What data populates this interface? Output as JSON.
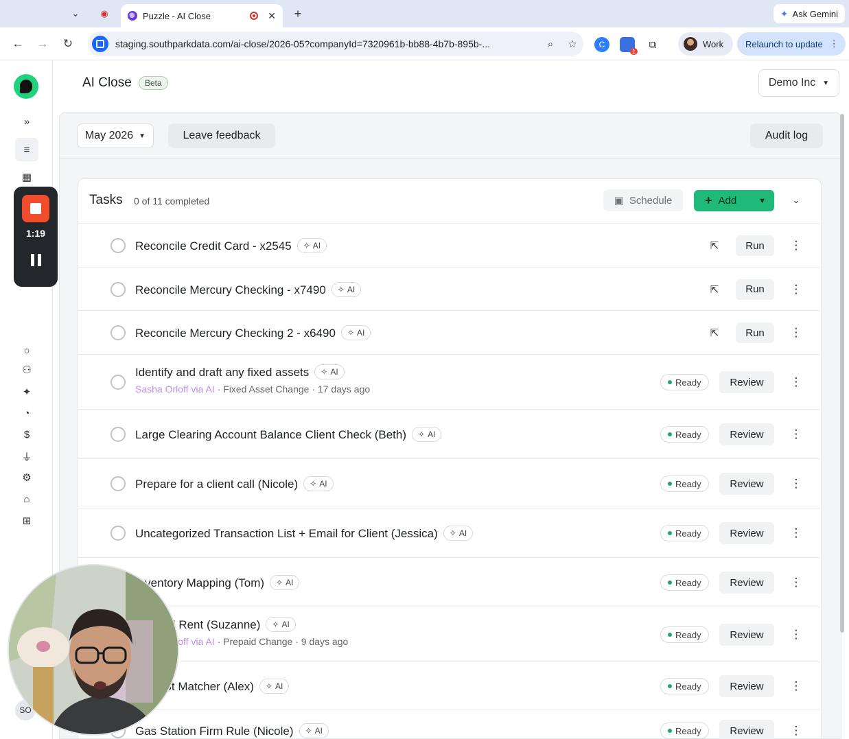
{
  "browser": {
    "active_tab_title": "Puzzle - AI Close",
    "ask_gemini": "Ask Gemini",
    "url": "staging.southparkdata.com/ai-close/2026-05?companyId=7320961b-bb88-4b7b-895b-...",
    "profile_label": "Work",
    "relaunch_label": "Relaunch to update",
    "extension_badge": "1"
  },
  "header": {
    "title": "AI Close",
    "badge": "Beta",
    "company": "Demo Inc"
  },
  "controls": {
    "month": "May 2026",
    "feedback": "Leave feedback",
    "audit": "Audit log"
  },
  "recorder": {
    "time": "1:19"
  },
  "sidebar": {
    "avatar_initials": "SO"
  },
  "tasks": {
    "title": "Tasks",
    "count": "0 of 11 completed",
    "schedule": "Schedule",
    "add": "Add",
    "ai_label": "AI",
    "run_label": "Run",
    "ready_label": "Ready",
    "review_label": "Review",
    "items": [
      {
        "name": "Reconcile Credit Card - x2545",
        "action": "run"
      },
      {
        "name": "Reconcile Mercury Checking - x7490",
        "action": "run"
      },
      {
        "name": "Reconcile Mercury Checking 2 - x6490",
        "action": "run"
      },
      {
        "name": "Identify and draft any fixed assets",
        "action": "review",
        "sub_via": "Sasha Orloff via AI",
        "sub_rest": " · Fixed Asset Change · 17 days ago"
      },
      {
        "name": "Large Clearing Account Balance Client Check (Beth)",
        "action": "review"
      },
      {
        "name": "Prepare for a client call (Nicole)",
        "action": "review"
      },
      {
        "name": "Uncategorized Transaction List + Email for Client (Jessica)",
        "action": "review"
      },
      {
        "name": "Inventory Mapping (Tom)",
        "action": "review"
      },
      {
        "name": "Prepaid Rent (Suzanne)",
        "action": "review",
        "sub_via": "Sasha Orloff via AI",
        "sub_rest": " · Prepaid Change · 9 days ago"
      },
      {
        "name": "Receipt Matcher (Alex)",
        "action": "review"
      },
      {
        "name": "Gas Station Firm Rule (Nicole)",
        "action": "review"
      }
    ]
  }
}
